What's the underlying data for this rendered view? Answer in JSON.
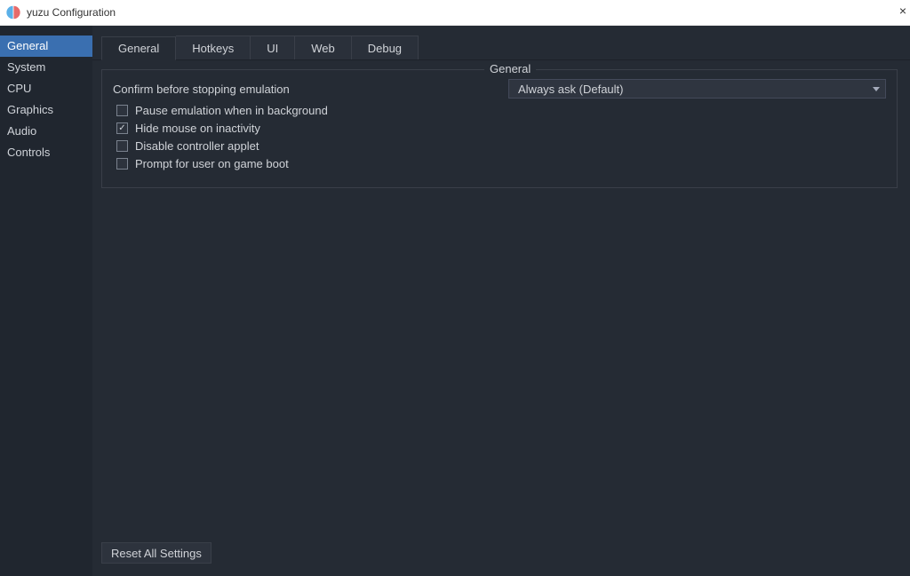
{
  "window": {
    "title": "yuzu Configuration",
    "close_glyph": "×"
  },
  "sidebar": {
    "items": [
      {
        "label": "General",
        "selected": true
      },
      {
        "label": "System",
        "selected": false
      },
      {
        "label": "CPU",
        "selected": false
      },
      {
        "label": "Graphics",
        "selected": false
      },
      {
        "label": "Audio",
        "selected": false
      },
      {
        "label": "Controls",
        "selected": false
      }
    ]
  },
  "tabs": [
    {
      "label": "General",
      "active": true
    },
    {
      "label": "Hotkeys",
      "active": false
    },
    {
      "label": "UI",
      "active": false
    },
    {
      "label": "Web",
      "active": false
    },
    {
      "label": "Debug",
      "active": false
    }
  ],
  "general_group": {
    "legend": "General",
    "confirm_label": "Confirm before stopping emulation",
    "checkboxes": [
      {
        "label": "Pause emulation when in background",
        "checked": false
      },
      {
        "label": "Hide mouse on inactivity",
        "checked": true
      },
      {
        "label": "Disable controller applet",
        "checked": false
      },
      {
        "label": "Prompt for user on game boot",
        "checked": false
      }
    ],
    "dropdown_value": "Always ask (Default)"
  },
  "buttons": {
    "reset_all": "Reset All Settings"
  }
}
